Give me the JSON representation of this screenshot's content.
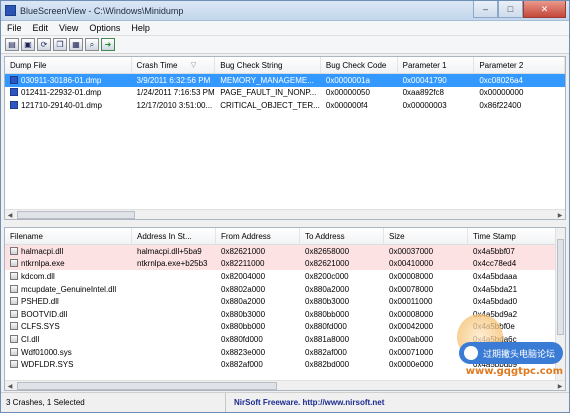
{
  "window": {
    "title": "BlueScreenView  -  C:\\Windows\\Minidump",
    "minimize": "–",
    "maximize": "□",
    "close": "✕"
  },
  "menu": [
    "File",
    "Edit",
    "View",
    "Options",
    "Help"
  ],
  "toolbar": {
    "icons": [
      "save-icon",
      "floppy-icon",
      "refresh-icon",
      "copy-icon",
      "properties-icon",
      "search-icon",
      "exit-icon"
    ],
    "glyphs": [
      "▤",
      "▣",
      "⟳",
      "❐",
      "▦",
      "⌕",
      "➜"
    ]
  },
  "crashes": {
    "columns": [
      "Dump File",
      "Crash Time",
      "Bug Check String",
      "Bug Check Code",
      "Parameter 1",
      "Parameter 2"
    ],
    "sort_arrow": "▽",
    "rows": [
      [
        "030911-30186-01.dmp",
        "3/9/2011 6:32:56 PM",
        "MEMORY_MANAGEME...",
        "0x0000001a",
        "0x00041790",
        "0xc08026a4"
      ],
      [
        "012411-22932-01.dmp",
        "1/24/2011 7:16:53 PM",
        "PAGE_FAULT_IN_NONP...",
        "0x00000050",
        "0xaa892fc8",
        "0x00000000"
      ],
      [
        "121710-29140-01.dmp",
        "12/17/2010 3:51:00...",
        "CRITICAL_OBJECT_TER...",
        "0x000000f4",
        "0x00000003",
        "0x86f22400"
      ]
    ],
    "selected_row": 0
  },
  "drivers": {
    "columns": [
      "Filename",
      "Address In St...",
      "From Address",
      "To Address",
      "Size",
      "Time Stamp"
    ],
    "rows": [
      [
        "halmacpi.dll",
        "halmacpi.dll+5ba9",
        "0x82621000",
        "0x82658000",
        "0x00037000",
        "0x4a5bbf07"
      ],
      [
        "ntkrnlpa.exe",
        "ntkrnlpa.exe+b25b3",
        "0x82211000",
        "0x82621000",
        "0x00410000",
        "0x4cc78ed4"
      ],
      [
        "kdcom.dll",
        "",
        "0x82004000",
        "0x8200c000",
        "0x00008000",
        "0x4a5bdaaa"
      ],
      [
        "mcupdate_GenuineIntel.dll",
        "",
        "0x8802a000",
        "0x880a2000",
        "0x00078000",
        "0x4a5bda21"
      ],
      [
        "PSHED.dll",
        "",
        "0x880a2000",
        "0x880b3000",
        "0x00011000",
        "0x4a5bdad0"
      ],
      [
        "BOOTVID.dll",
        "",
        "0x880b3000",
        "0x880bb000",
        "0x00008000",
        "0x4a5bd9a2"
      ],
      [
        "CLFS.SYS",
        "",
        "0x880bb000",
        "0x880fd000",
        "0x00042000",
        "0x4a5bbf0e"
      ],
      [
        "CI.dll",
        "",
        "0x880fd000",
        "0x881a8000",
        "0x000ab000",
        "0x4a5bda6c"
      ],
      [
        "Wdf01000.sys",
        "",
        "0x8823e000",
        "0x882af000",
        "0x00071000",
        "0x4a5bbdb8"
      ],
      [
        "WDFLDR.SYS",
        "",
        "0x882af000",
        "0x882bd000",
        "0x0000e000",
        "0x4a5bbdb9"
      ]
    ],
    "highlighted_rows": [
      0,
      1
    ]
  },
  "status": {
    "count": "3 Crashes, 1 Selected",
    "credit": "NirSoft Freeware.  http://www.nirsoft.net"
  },
  "watermark": {
    "pill_text": "过期撇头电脑论坛",
    "url": "www.gqgtpc.com"
  }
}
